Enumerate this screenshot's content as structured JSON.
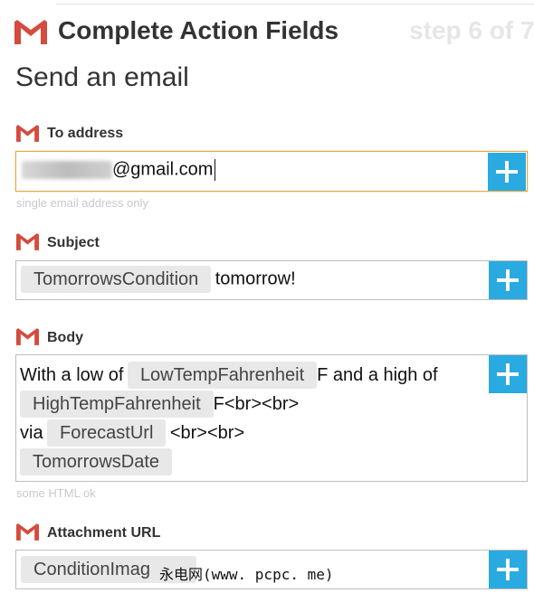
{
  "header": {
    "title": "Complete Action Fields",
    "step": "step 6 of 7",
    "action_name": "Send an email"
  },
  "fields": {
    "to_address": {
      "label": "To address",
      "value_visible": "@gmail.com",
      "hint": "single email address only"
    },
    "subject": {
      "label": "Subject",
      "token": "TomorrowsCondition",
      "text": "tomorrow!"
    },
    "body": {
      "label": "Body",
      "line1_text_a": "With a low of",
      "token_low": "LowTempFahrenheit",
      "line1_text_b": "F and a high of",
      "token_high": "HighTempFahrenheit",
      "line2_text": "F<br><br>",
      "line3_text_a": "via",
      "token_forecast": "ForecastUrl",
      "line3_text_b": "<br><br>",
      "token_date": "TomorrowsDate",
      "hint": "some HTML ok"
    },
    "attachment_url": {
      "label": "Attachment URL",
      "token": "ConditionImag"
    }
  },
  "watermark": "永电网(www. pcpc. me)",
  "colors": {
    "accent_blue": "#29abe2",
    "focus_border": "#e2a94a",
    "gmail_red": "#d54b3d",
    "token_bg": "#e8e8e8"
  }
}
